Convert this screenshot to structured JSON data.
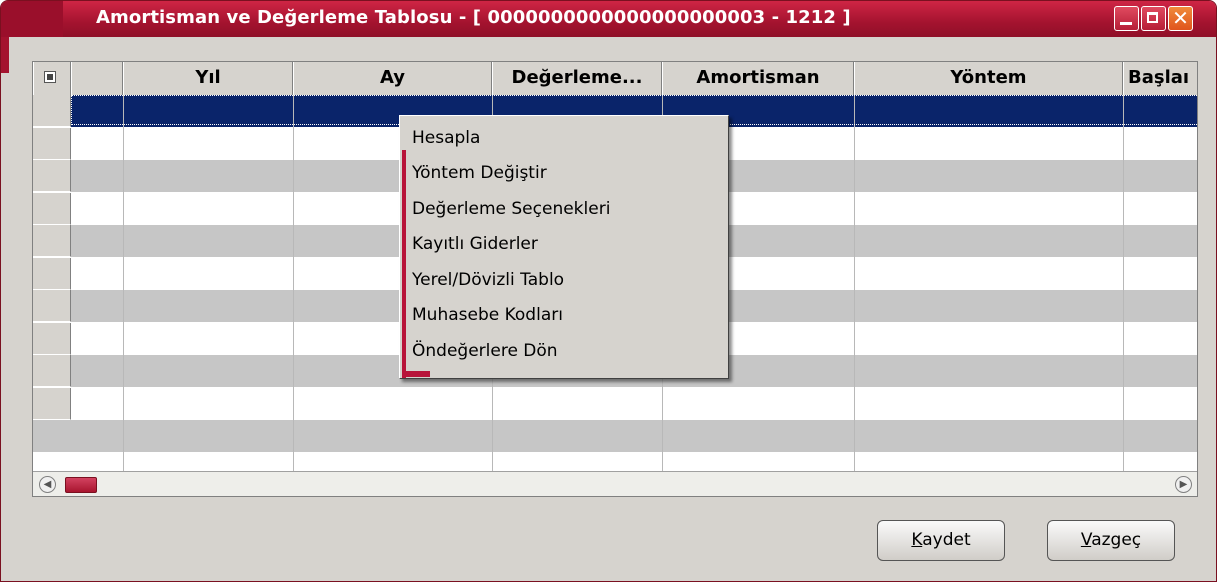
{
  "window": {
    "title": "Amortisman ve Değerleme Tablosu - [ 0000000000000000000003 - 1212 ]",
    "controls": [
      "minimize-icon",
      "maximize-icon",
      "close-icon"
    ],
    "close_glyph": "✕"
  },
  "grid": {
    "columns": [
      "Yıl",
      "Ay",
      "Değerleme...",
      "Amortisman",
      "Yöntem",
      "Başlaı"
    ],
    "rows_visible": 11,
    "selected_row": 0
  },
  "context_menu": {
    "items": [
      "Hesapla",
      "Yöntem Değiştir",
      "Değerleme Seçenekleri",
      "Kayıtlı Giderler",
      "Yerel/Dövizli Tablo",
      "Muhasebe Kodları",
      "Öndeğerlere Dön"
    ]
  },
  "buttons": {
    "save_mnemonic": "K",
    "save_rest": "aydet",
    "cancel_mnemonic": "V",
    "cancel_rest": "azgeç"
  },
  "colors": {
    "title_bar": "#a4132f",
    "selection": "#0a246a",
    "accent": "#b8143a"
  }
}
